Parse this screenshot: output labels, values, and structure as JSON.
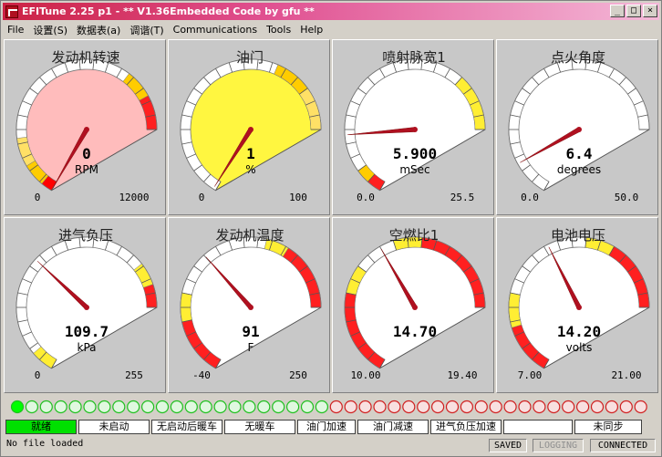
{
  "window": {
    "title": "EFITune 2.25 p1 - ** V1.36Embedded Code by gfu **"
  },
  "menu": [
    "File",
    "设置(S)",
    "数据表(a)",
    "调谐(T)",
    "Communications",
    "Tools",
    "Help"
  ],
  "gauges": [
    {
      "title": "发动机转速",
      "value": "0",
      "unit": "RPM",
      "min": "0",
      "max": "12000",
      "vmin": 0,
      "vmax": 12000,
      "v": 0,
      "face": "#ffbcbc",
      "type": "rpm"
    },
    {
      "title": "油门",
      "value": "1",
      "unit": "%",
      "min": "0",
      "max": "100",
      "vmin": 0,
      "vmax": 100,
      "v": 1,
      "face": "#fff640",
      "type": "tps"
    },
    {
      "title": "喷射脉宽1",
      "value": "5.900",
      "unit": "mSec",
      "min": "0.0",
      "max": "25.5",
      "vmin": 0,
      "vmax": 25.5,
      "v": 5.9,
      "face": "#ffffff",
      "type": "pw"
    },
    {
      "title": "点火角度",
      "value": "6.4",
      "unit": "degrees",
      "min": "0.0",
      "max": "50.0",
      "vmin": 0,
      "vmax": 50,
      "v": 6.4,
      "face": "#ffffff",
      "type": "adv"
    },
    {
      "title": "进气负压",
      "value": "109.7",
      "unit": "kPa",
      "min": "0",
      "max": "255",
      "vmin": 0,
      "vmax": 255,
      "v": 109.7,
      "face": "#ffffff",
      "type": "map"
    },
    {
      "title": "发动机温度",
      "value": "91",
      "unit": "F",
      "min": "-40",
      "max": "250",
      "vmin": -40,
      "vmax": 250,
      "v": 91,
      "face": "#ffffff",
      "type": "clt"
    },
    {
      "title": "空燃比1",
      "value": "14.70",
      "unit": "",
      "min": "10.00",
      "max": "19.40",
      "vmin": 10,
      "vmax": 19.4,
      "v": 14.7,
      "face": "#ffffff",
      "type": "afr"
    },
    {
      "title": "电池电压",
      "value": "14.20",
      "unit": "volts",
      "min": "7.00",
      "max": "21.00",
      "vmin": 7,
      "vmax": 21,
      "v": 14.2,
      "face": "#ffffff",
      "type": "bat"
    }
  ],
  "leds": {
    "green_count": 22,
    "red_count": 22,
    "lit_index": 0
  },
  "status": [
    "就绪",
    "未启动",
    "无启动后暖车",
    "无暖车",
    "油门加速",
    "油门减速",
    "进气负压加速",
    "",
    "未同步"
  ],
  "footer": {
    "file": "No file loaded",
    "saved": "SAVED",
    "logging": "LOGGING",
    "connected": "CONNECTED"
  }
}
